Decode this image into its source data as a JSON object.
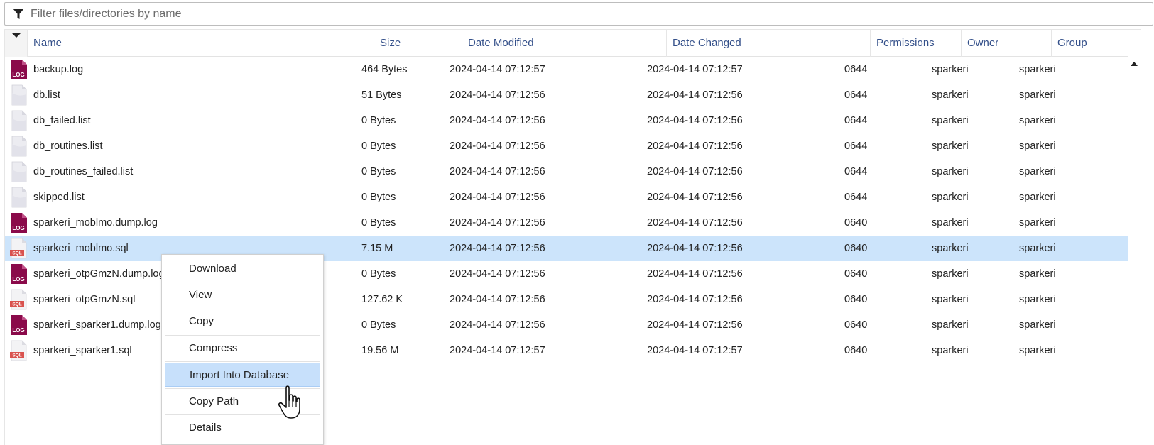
{
  "filter": {
    "placeholder": "Filter files/directories by name",
    "icon": "filter-icon"
  },
  "columns": [
    "Name",
    "Size",
    "Date Modified",
    "Date Changed",
    "Permissions",
    "Owner",
    "Group"
  ],
  "files": [
    {
      "name": "backup.log",
      "type": "log",
      "size": "464 Bytes",
      "modified": "2024-04-14 07:12:57",
      "changed": "2024-04-14 07:12:57",
      "perms": "0644",
      "owner": "sparkeri",
      "group": "sparkeri"
    },
    {
      "name": "db.list",
      "type": "generic",
      "size": "51 Bytes",
      "modified": "2024-04-14 07:12:56",
      "changed": "2024-04-14 07:12:56",
      "perms": "0644",
      "owner": "sparkeri",
      "group": "sparkeri"
    },
    {
      "name": "db_failed.list",
      "type": "generic",
      "size": "0 Bytes",
      "modified": "2024-04-14 07:12:56",
      "changed": "2024-04-14 07:12:56",
      "perms": "0644",
      "owner": "sparkeri",
      "group": "sparkeri"
    },
    {
      "name": "db_routines.list",
      "type": "generic",
      "size": "0 Bytes",
      "modified": "2024-04-14 07:12:56",
      "changed": "2024-04-14 07:12:56",
      "perms": "0644",
      "owner": "sparkeri",
      "group": "sparkeri"
    },
    {
      "name": "db_routines_failed.list",
      "type": "generic",
      "size": "0 Bytes",
      "modified": "2024-04-14 07:12:56",
      "changed": "2024-04-14 07:12:56",
      "perms": "0644",
      "owner": "sparkeri",
      "group": "sparkeri"
    },
    {
      "name": "skipped.list",
      "type": "generic",
      "size": "0 Bytes",
      "modified": "2024-04-14 07:12:56",
      "changed": "2024-04-14 07:12:56",
      "perms": "0644",
      "owner": "sparkeri",
      "group": "sparkeri"
    },
    {
      "name": "sparkeri_moblmo.dump.log",
      "type": "log",
      "size": "0 Bytes",
      "modified": "2024-04-14 07:12:56",
      "changed": "2024-04-14 07:12:56",
      "perms": "0640",
      "owner": "sparkeri",
      "group": "sparkeri"
    },
    {
      "name": "sparkeri_moblmo.sql",
      "type": "sql",
      "size": "7.15 M",
      "modified": "2024-04-14 07:12:56",
      "changed": "2024-04-14 07:12:56",
      "perms": "0640",
      "owner": "sparkeri",
      "group": "sparkeri",
      "selected": true
    },
    {
      "name": "sparkeri_otpGmzN.dump.log",
      "type": "log",
      "size": "0 Bytes",
      "modified": "2024-04-14 07:12:56",
      "changed": "2024-04-14 07:12:56",
      "perms": "0640",
      "owner": "sparkeri",
      "group": "sparkeri"
    },
    {
      "name": "sparkeri_otpGmzN.sql",
      "type": "sql",
      "size": "127.62 K",
      "modified": "2024-04-14 07:12:56",
      "changed": "2024-04-14 07:12:56",
      "perms": "0640",
      "owner": "sparkeri",
      "group": "sparkeri"
    },
    {
      "name": "sparkeri_sparker1.dump.log",
      "type": "log",
      "size": "0 Bytes",
      "modified": "2024-04-14 07:12:56",
      "changed": "2024-04-14 07:12:56",
      "perms": "0640",
      "owner": "sparkeri",
      "group": "sparkeri"
    },
    {
      "name": "sparkeri_sparker1.sql",
      "type": "sql",
      "size": "19.56 M",
      "modified": "2024-04-14 07:12:57",
      "changed": "2024-04-14 07:12:57",
      "perms": "0640",
      "owner": "sparkeri",
      "group": "sparkeri"
    }
  ],
  "icon_labels": {
    "log": "LOG",
    "sql": "SQL"
  },
  "context_menu": {
    "items": [
      "Download",
      "View",
      "Copy",
      "Compress",
      "Import Into Database",
      "Copy Path",
      "Details"
    ],
    "hovered": "Import Into Database"
  },
  "colors": {
    "log_icon": "#8a0a4a",
    "sql_icon": "#d9534f",
    "selected_row": "#cce4fb",
    "menu_hover": "#c7e0fb",
    "header_text": "#34508a"
  }
}
